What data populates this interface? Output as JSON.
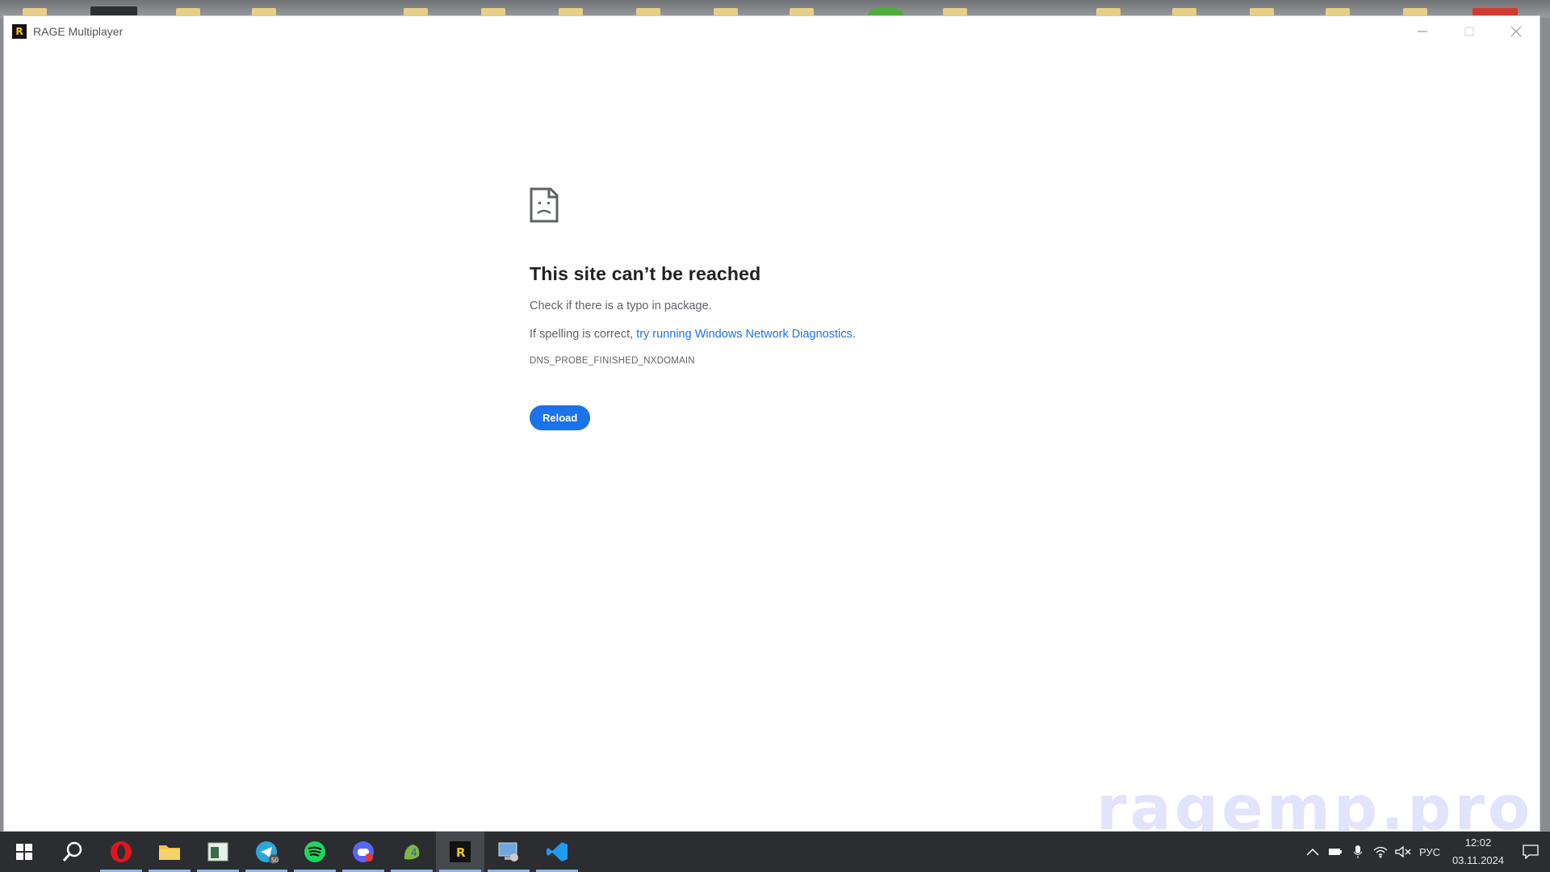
{
  "window": {
    "title": "RAGE Multiplayer",
    "logo_letter": "R"
  },
  "error_page": {
    "title": "This site can’t be reached",
    "line1": "Check if there is a typo in package.",
    "line2_prefix": "If spelling is correct, ",
    "line2_link": "try running Windows Network Diagnostics",
    "line2_suffix": ".",
    "error_code": "DNS_PROBE_FINISHED_NXDOMAIN",
    "reload_label": "Reload"
  },
  "watermark": "ragemp.pro",
  "taskbar": {
    "apps": [
      {
        "name": "start-button-icon"
      },
      {
        "name": "search-icon"
      },
      {
        "name": "opera-icon"
      },
      {
        "name": "file-explorer-icon"
      },
      {
        "name": "notepad-window-icon"
      },
      {
        "name": "telegram-icon",
        "badge": "50"
      },
      {
        "name": "spotify-icon"
      },
      {
        "name": "discord-icon"
      },
      {
        "name": "notepad-plus-icon"
      },
      {
        "name": "rage-mp-icon"
      },
      {
        "name": "remote-desktop-icon"
      },
      {
        "name": "vscode-icon"
      }
    ],
    "language": "РУС",
    "time": "12:02",
    "date": "03.11.2024"
  },
  "colors": {
    "link": "#1a73e8",
    "button": "#1a73e8",
    "taskbar": "#2b2d30"
  }
}
